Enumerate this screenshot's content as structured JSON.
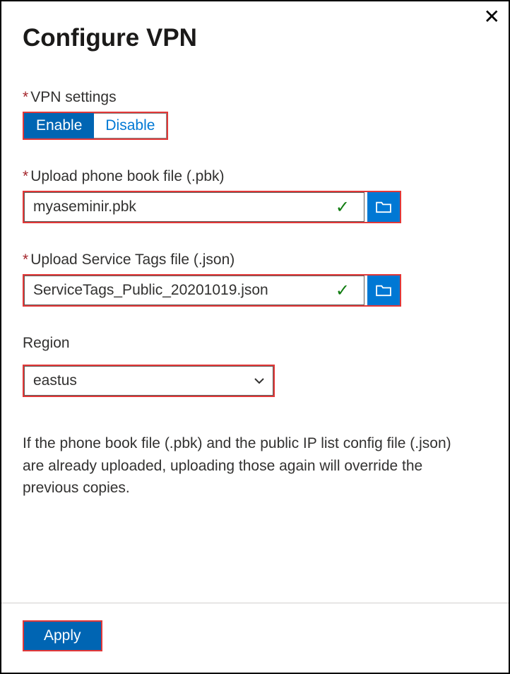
{
  "close_label": "✕",
  "title": "Configure VPN",
  "fields": {
    "vpn_settings": {
      "label": "VPN settings",
      "required": true,
      "options": {
        "enable": "Enable",
        "disable": "Disable"
      },
      "selected": "enable"
    },
    "phone_book": {
      "label": "Upload phone book file (.pbk)",
      "required": true,
      "value": "myaseminir.pbk",
      "valid": true
    },
    "service_tags": {
      "label": "Upload Service Tags file (.json)",
      "required": true,
      "value": "ServiceTags_Public_20201019.json",
      "valid": true
    },
    "region": {
      "label": "Region",
      "required": false,
      "value": "eastus"
    }
  },
  "info_text": "If the phone book file (.pbk) and the public IP list config file (.json) are already uploaded, uploading those again will override the previous copies.",
  "footer": {
    "apply": "Apply"
  },
  "asterisk": "*"
}
